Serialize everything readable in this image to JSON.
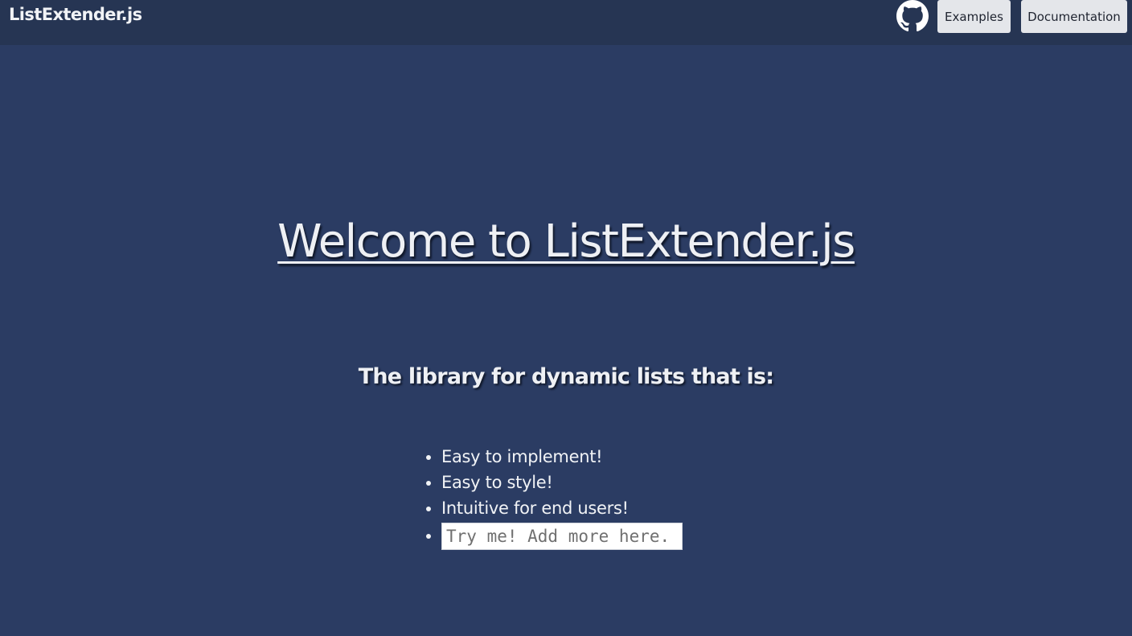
{
  "navbar": {
    "brand": "ListExtender.js",
    "github_icon": "github-icon",
    "examples_label": "Examples",
    "documentation_label": "Documentation"
  },
  "hero": {
    "title": "Welcome to ListExtender.js",
    "subtitle": "The library for dynamic lists that is:"
  },
  "features": {
    "items": [
      "Easy to implement!",
      "Easy to style!",
      "Intuitive for end users!"
    ],
    "input_placeholder": "Try me! Add more here."
  },
  "colors": {
    "background": "#2b3c63",
    "navbar": "#263553",
    "button": "#e4e6ea",
    "text": "#f1f3f6"
  }
}
